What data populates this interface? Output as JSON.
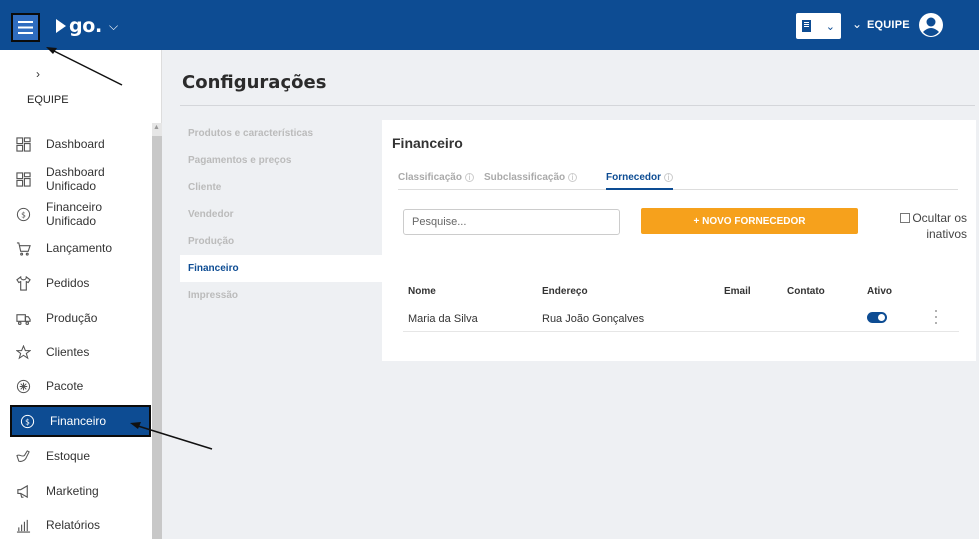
{
  "header": {
    "logo_text": "go.",
    "team_label": "EQUIPE"
  },
  "sidebar": {
    "team_name": "EQUIPE",
    "items": [
      {
        "label": "Dashboard",
        "icon": "dashboard-icon"
      },
      {
        "label": "Dashboard Unificado",
        "icon": "dashboard-icon"
      },
      {
        "label": "Financeiro Unificado",
        "icon": "dollar-circle-icon"
      },
      {
        "label": "Lançamento",
        "icon": "cart-icon"
      },
      {
        "label": "Pedidos",
        "icon": "shirt-icon"
      },
      {
        "label": "Produção",
        "icon": "truck-icon"
      },
      {
        "label": "Clientes",
        "icon": "star-icon"
      },
      {
        "label": "Pacote",
        "icon": "package-icon"
      },
      {
        "label": "Financeiro",
        "icon": "dollar-circle-icon"
      },
      {
        "label": "Estoque",
        "icon": "stock-icon"
      },
      {
        "label": "Marketing",
        "icon": "megaphone-icon"
      },
      {
        "label": "Relatórios",
        "icon": "chart-icon"
      }
    ],
    "active": "Financeiro"
  },
  "page": {
    "title": "Configurações",
    "sub_menu": [
      "Produtos e características",
      "Pagamentos e preços",
      "Cliente",
      "Vendedor",
      "Produção",
      "Financeiro",
      "Impressão"
    ],
    "active_sub": "Financeiro"
  },
  "panel": {
    "title": "Financeiro",
    "tabs": [
      "Classificação",
      "Subclassificação",
      "Fornecedor"
    ],
    "active_tab": "Fornecedor",
    "search_placeholder": "Pesquise...",
    "new_button": "+ NOVO FORNECEDOR",
    "hide_inactive_label": "Ocultar os inativos",
    "table": {
      "headers": [
        "Nome",
        "Endereço",
        "Email",
        "Contato",
        "Ativo"
      ],
      "rows": [
        {
          "nome": "Maria da Silva",
          "endereco": "Rua João Gonçalves",
          "email": "",
          "contato": "",
          "ativo": true
        }
      ]
    }
  },
  "colors": {
    "brand": "#0d4c93",
    "accent": "#f6a11c"
  }
}
